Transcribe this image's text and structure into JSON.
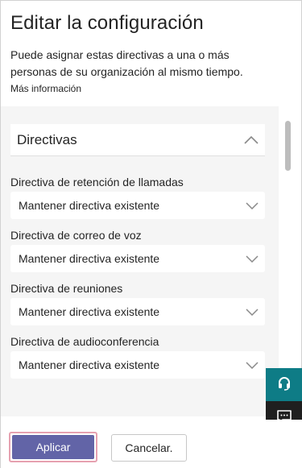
{
  "header": {
    "title": "Editar la configuración",
    "description": "Puede asignar estas directivas a una o más personas de su organización al mismo tiempo.",
    "more_info_link": "Más información"
  },
  "policies_section": {
    "title": "Directivas",
    "expanded_icon": "chevron-up-icon",
    "fields": [
      {
        "label": "Directiva de retención de llamadas",
        "value": "Mantener directiva existente"
      },
      {
        "label": "Directiva de correo de voz",
        "value": "Mantener directiva existente"
      },
      {
        "label": "Directiva de reuniones",
        "value": "Mantener directiva existente"
      },
      {
        "label": "Directiva de audioconferencia",
        "value": "Mantener directiva existente"
      }
    ]
  },
  "side_buttons": {
    "help_icon": "headset-icon",
    "help_color": "#0e7c86",
    "feedback_icon": "chat-icon",
    "feedback_color": "#1f1f1f"
  },
  "footer": {
    "apply_label": "Aplicar",
    "cancel_label": "Cancelar.",
    "apply_color": "#6264a7"
  }
}
